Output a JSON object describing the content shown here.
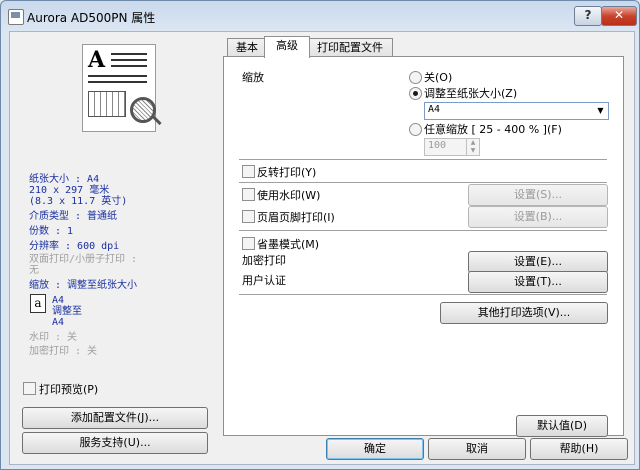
{
  "window": {
    "title": "Aurora AD500PN 属性",
    "help_label": "?",
    "close_label": "✕"
  },
  "left": {
    "info_paper_label": "纸张大小 : A4",
    "info_paper_dims": "210 x 297 毫米\n(8.3 x 11.7 英寸)",
    "info_media": "介质类型 : 普通纸",
    "info_copies": "份数 : 1",
    "info_resolution": "分辨率 : 600 dpi",
    "info_duplex": "双面打印/小册子打印 :\n无",
    "info_scaling": "缩放 : 调整至纸张大小",
    "info_scale_icon_letter": "a",
    "info_scale_detail": "A4\n调整至\nA4",
    "info_watermark": "水印 : 关",
    "info_secure": "加密打印 : 关",
    "print_preview_label": "打印预览(P)",
    "add_profile_label": "添加配置文件(J)...",
    "support_label": "服务支持(U)..."
  },
  "tabs": [
    {
      "label": "基本"
    },
    {
      "label": "高级"
    },
    {
      "label": "打印配置文件"
    }
  ],
  "advanced": {
    "scaling_label": "缩放",
    "radio_off": "关(O)",
    "radio_fit": "调整至纸张大小(Z)",
    "fit_paper_value": "A4",
    "radio_free": "任意缩放 [ 25 - 400 % ](F)",
    "free_value": "100",
    "mirror_label": "反转打印(Y)",
    "watermark_label": "使用水印(W)",
    "watermark_settings": "设置(S)...",
    "header_footer_label": "页眉页脚打印(I)",
    "header_footer_settings": "设置(B)...",
    "toner_save_label": "省墨模式(M)",
    "secure_print_label": "加密打印",
    "secure_settings": "设置(E)...",
    "user_auth_label": "用户认证",
    "user_auth_settings": "设置(T)...",
    "other_options_label": "其他打印选项(V)...",
    "default_label": "默认值(D)"
  },
  "footer": {
    "ok_label": "确定",
    "cancel_label": "取消",
    "help_label": "帮助(H)"
  }
}
